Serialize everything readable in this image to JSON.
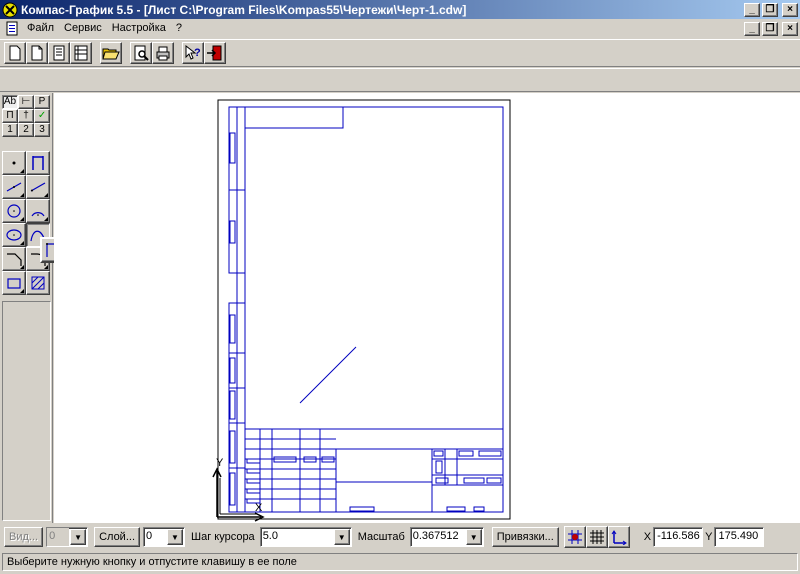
{
  "window": {
    "title": "Компас-График 5.5 - [Лист C:\\Program Files\\Kompas55\\Чертежи\\Черт-1.cdw]"
  },
  "caption_buttons": {
    "minimize": "_",
    "restore": "❐",
    "close": "×"
  },
  "menu": {
    "items": [
      "Файл",
      "Сервис",
      "Настройка",
      "?"
    ]
  },
  "left_tabs": {
    "row1": [
      "Ab",
      "⊢",
      "P"
    ],
    "row2": [
      "П",
      "†",
      "✓"
    ],
    "row3": [
      "1",
      "2",
      "3"
    ]
  },
  "controls": {
    "view_button": "Вид...",
    "view_value": "0",
    "layer_button": "Слой...",
    "layer_value": "0",
    "cursor_step_label": "Шаг курсора",
    "cursor_step_value": "5.0",
    "scale_label": "Масштаб",
    "scale_value": "0.367512",
    "snaps_button": "Привязки...",
    "x_label": "X",
    "x_value": "-116.586",
    "y_label": "Y",
    "y_value": "175.490"
  },
  "axis_labels": {
    "x": "X",
    "y": "Y"
  },
  "status": {
    "message": "Выберите нужную кнопку и отпустите клавишу в ее поле"
  },
  "colors": {
    "title_gradient_start": "#0a246a",
    "title_gradient_end": "#a6caf0",
    "drawing_line": "#0000c0",
    "face": "#d4d0c8"
  }
}
